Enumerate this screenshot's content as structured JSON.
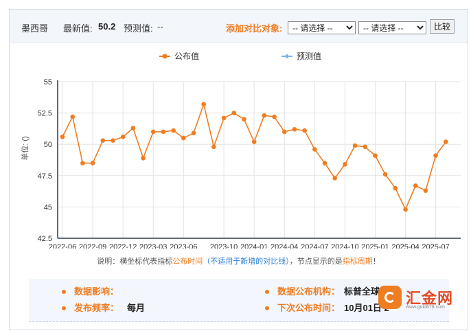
{
  "header": {
    "country": "墨西哥",
    "latest_label": "最新值:",
    "latest_value": "50.2",
    "forecast_label": "预测值:",
    "forecast_value": "--",
    "compare_label": "添加对比对象:",
    "select_placeholder": "-- 请选择 --",
    "compare_button": "比较"
  },
  "chart_data": {
    "type": "line",
    "title": "",
    "xlabel": "",
    "ylabel": "单位: ()",
    "ylim": [
      42.5,
      55
    ],
    "yticks": [
      "42.5",
      "45",
      "47.5",
      "50",
      "52.5",
      "55"
    ],
    "x_ticks": [
      "2022-06",
      "2022-09",
      "2022-12",
      "2023-03",
      "2023-06",
      "2023-10",
      "2024-01",
      "2024-04",
      "2024-07",
      "2024-10",
      "2025-01",
      "2025-04",
      "2025-07"
    ],
    "x": [
      "2022-06",
      "2022-07",
      "2022-08",
      "2022-09",
      "2022-10",
      "2022-11",
      "2022-12",
      "2023-01",
      "2023-02",
      "2023-03",
      "2023-04",
      "2023-05",
      "2023-06",
      "2023-07",
      "2023-08",
      "2023-09",
      "2023-10",
      "2023-11",
      "2023-12",
      "2024-01",
      "2024-02",
      "2024-03",
      "2024-04",
      "2024-05",
      "2024-06",
      "2024-07",
      "2024-08",
      "2024-09",
      "2024-10",
      "2024-11",
      "2024-12",
      "2025-01",
      "2025-02",
      "2025-03",
      "2025-04",
      "2025-05",
      "2025-06",
      "2025-07",
      "2025-08",
      "2025-09"
    ],
    "legend_position": "top",
    "grid": true,
    "series": [
      {
        "name": "公布值",
        "color": "#ef7d22",
        "values": [
          50.6,
          52.2,
          48.5,
          48.5,
          50.3,
          50.3,
          50.6,
          51.3,
          48.9,
          51.0,
          51.0,
          51.1,
          50.5,
          50.9,
          53.2,
          49.8,
          52.1,
          52.5,
          52.0,
          50.2,
          52.3,
          52.2,
          51.0,
          51.2,
          51.1,
          49.6,
          48.5,
          47.3,
          48.4,
          49.9,
          49.8,
          49.1,
          47.6,
          46.5,
          44.8,
          46.7,
          46.3,
          49.1,
          50.2
        ]
      },
      {
        "name": "预测值",
        "color": "#7fb3e8",
        "values": []
      }
    ]
  },
  "note": {
    "prefix": "说明：横坐标代表指标",
    "publish_time": "公布时间",
    "paren": "（不适用于新增的对比线）",
    "middle": "，节点显示的是",
    "period": "指标周期",
    "suffix": "！"
  },
  "info": {
    "impact_label": "数据影响：",
    "impact_value": "",
    "agency_label": "数据公布机构：",
    "agency_value": "标普全球",
    "freq_label": "发布频率：",
    "freq_value": "每月",
    "next_label": "下次公布时间：",
    "next_value": "10月01日 2"
  },
  "logo": {
    "name": "汇金网",
    "url": "www.gold678.com"
  }
}
